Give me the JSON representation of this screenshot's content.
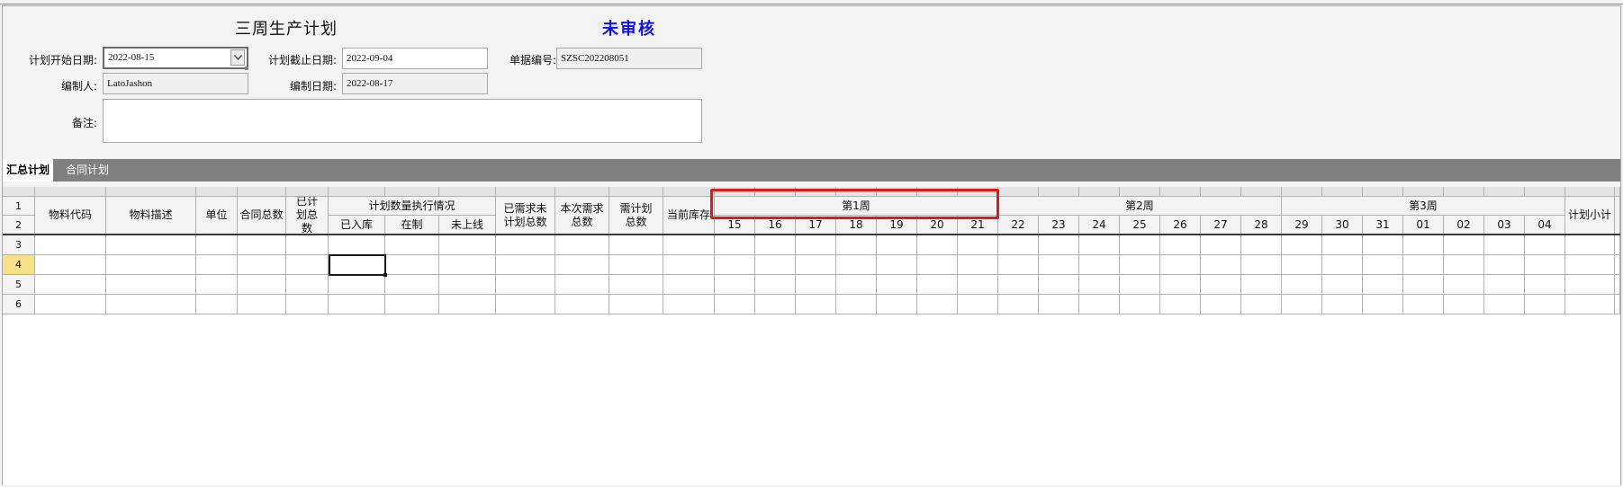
{
  "form": {
    "title": "三周生产计划",
    "status": "未审核",
    "plan_start_label": "计划开始日期:",
    "plan_start_value": "2022-08-15",
    "plan_end_label": "计划截止日期:",
    "plan_end_value": "2022-09-04",
    "doc_no_label": "单据编号:",
    "doc_no_value": "SZSC202208051",
    "author_label": "编制人:",
    "author_value": "LatoJashon",
    "author_date_label": "编制日期:",
    "author_date_value": "2022-08-17",
    "memo_label": "备注:",
    "memo_value": ""
  },
  "tabs": [
    {
      "label": "汇总计划",
      "active": true
    },
    {
      "label": "合同计划",
      "active": false
    }
  ],
  "grid": {
    "row_numbers": [
      "1",
      "2",
      "3",
      "4",
      "5",
      "6"
    ],
    "headers": {
      "material_code": "物料代码",
      "material_desc": "物料描述",
      "unit": "单位",
      "contract_total": "合同总数",
      "planned_total": "已计划总数",
      "exec_group": "计划数量执行情况",
      "stocked_in": "已入库",
      "in_process": "在制",
      "not_online": "未上线",
      "demanded_unplanned": "已需求未计划总数",
      "this_demand": "本次需求总数",
      "needed_plan": "需计划总数",
      "current_stock": "当前库存",
      "subtotal": "计划小计"
    },
    "weeks": [
      {
        "label": "第1周",
        "days": [
          "15",
          "16",
          "17",
          "18",
          "19",
          "20",
          "21"
        ]
      },
      {
        "label": "第2周",
        "days": [
          "22",
          "23",
          "24",
          "25",
          "26",
          "27",
          "28"
        ]
      },
      {
        "label": "第3周",
        "days": [
          "29",
          "30",
          "31",
          "01",
          "02",
          "03",
          "04"
        ]
      }
    ],
    "selected_row": "4"
  },
  "icons": {
    "dropdown": "chevron-down-icon"
  },
  "colors": {
    "status": "#1010e0",
    "highlight_box": "#e01818",
    "tab_bar": "#808080",
    "selected_row_header": "#f6e08a"
  }
}
